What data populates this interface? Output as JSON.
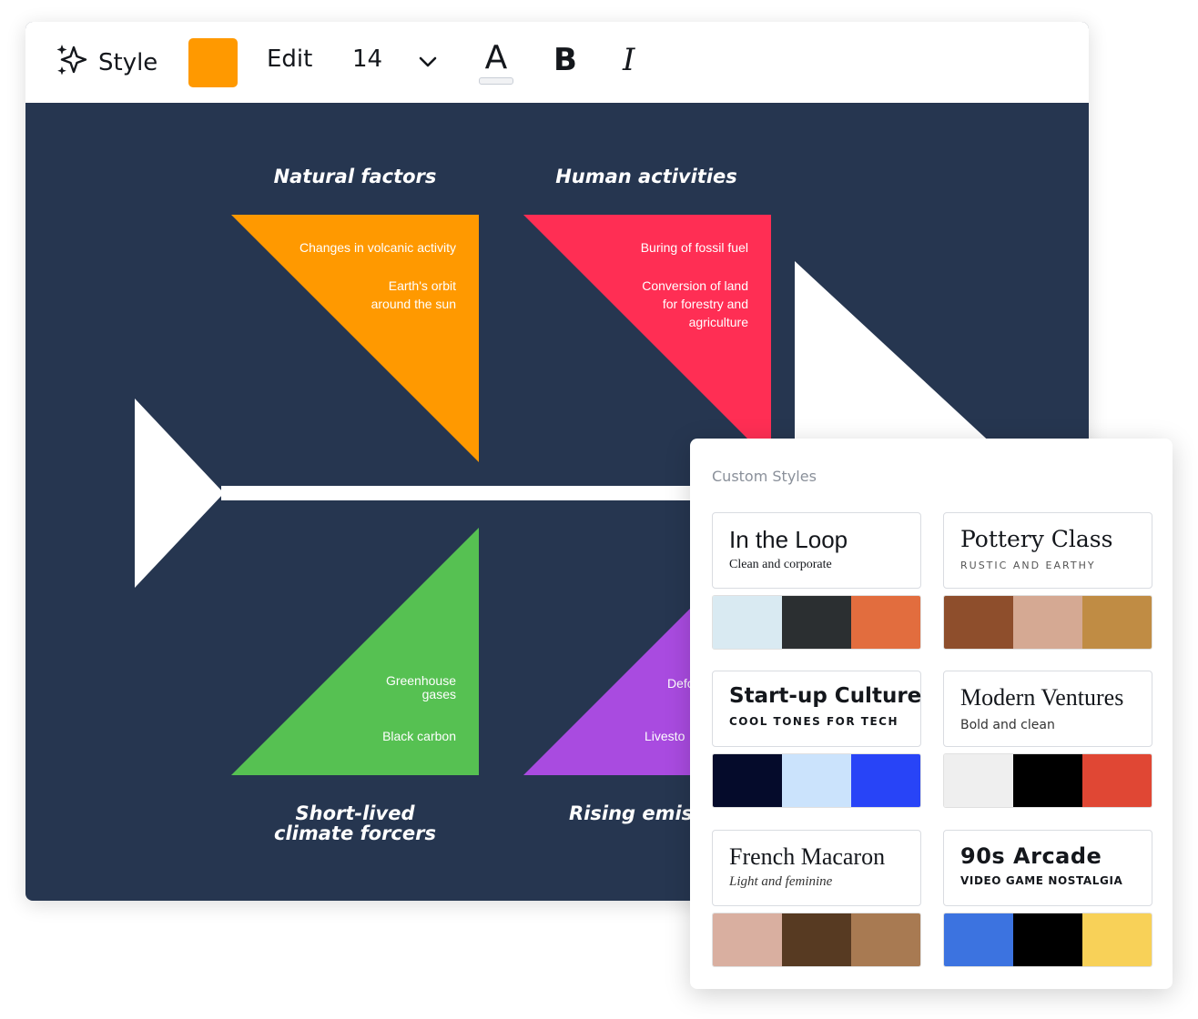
{
  "toolbar": {
    "style_label": "Style",
    "swatch_color": "#FF9900",
    "edit_label": "Edit",
    "font_size": "14",
    "font_color_letter": "A",
    "bold_label": "B",
    "italic_label": "I",
    "icons": [
      "sparkle-icon",
      "chevron-down-icon"
    ]
  },
  "diagram": {
    "background": "#263650",
    "headings": {
      "natural": "Natural factors",
      "human": "Human activities",
      "short_lived_line1": "Short-lived",
      "short_lived_line2": "climate forcers",
      "rising": "Rising emissi"
    },
    "natural": {
      "color": "#FF9900",
      "items": [
        "Changes in volcanic activity",
        "Earth's orbit",
        "around the sun"
      ]
    },
    "human": {
      "color": "#FF2E54",
      "items": [
        "Buring of fossil fuel",
        "Conversion of land",
        "for forestry and",
        "agriculture"
      ]
    },
    "short_lived": {
      "color": "#56C152",
      "items": [
        "Greenhouse",
        "gases",
        "Black carbon"
      ]
    },
    "rising": {
      "color": "#A94BE0",
      "items": [
        "Defo",
        "Livesto"
      ]
    }
  },
  "panel": {
    "title": "Custom Styles",
    "cards": [
      {
        "name": "In the Loop",
        "sub": "Clean and corporate",
        "colors": [
          "#D9EAF2",
          "#2B2F31",
          "#E26D3E"
        ]
      },
      {
        "name": "Pottery Class",
        "sub": "RUSTIC AND EARTHY",
        "colors": [
          "#8E4E2C",
          "#D5A993",
          "#C08C44"
        ]
      },
      {
        "name": "Start-up Culture",
        "sub": "COOL TONES FOR TECH",
        "colors": [
          "#050B2B",
          "#CBE3FC",
          "#2844F7"
        ]
      },
      {
        "name": "Modern Ventures",
        "sub": "Bold and clean",
        "colors": [
          "#EFEFEF",
          "#000000",
          "#E04734"
        ]
      },
      {
        "name": "French Macaron",
        "sub": "Light and feminine",
        "colors": [
          "#D9AFA0",
          "#573A22",
          "#A87A52"
        ]
      },
      {
        "name": "90s Arcade",
        "sub": "VIDEO GAME NOSTALGIA",
        "colors": [
          "#3C73E0",
          "#000000",
          "#F8D158"
        ]
      }
    ]
  }
}
